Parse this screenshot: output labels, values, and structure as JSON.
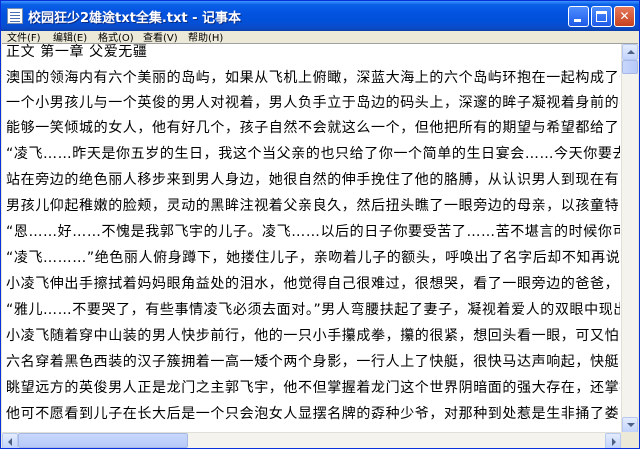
{
  "window": {
    "title": "校园狂少2雄途txt全集.txt - 记事本",
    "minimize_label": "_",
    "maximize_label": "□",
    "close_label": "✕"
  },
  "menu": [
    {
      "label": "文件(F)"
    },
    {
      "label": "编辑(E)"
    },
    {
      "label": "格式(O)"
    },
    {
      "label": "查看(V)"
    },
    {
      "label": "帮助(H)"
    }
  ],
  "content": {
    "lines": [
      "正文 第一章 父爱无疆",
      "澳国的领海内有六个美丽的岛屿，如果从飞机上俯瞰，深蓝大海上的六个岛屿环抱在一起构成了一个很标准",
      "一个小男孩儿与一个英俊的男人对视着，男人负手立于岛边的码头上，深邃的眸子凝视着身前的孩子，目光",
      "能够一笑倾城的女人，他有好几个，孩子自然不会就这么一个，但他把所有的期望与希望都给了身前五岁的",
      "“凌飞……昨天是你五岁的生日，我这个当父亲的也只给了你一个简单的生日宴会……今天你要去哪里",
      "站在旁边的绝色丽人移步来到男人身边，她很自然的伸手挽住了他的胳膊，从认识男人到现在有十多",
      "男孩儿仰起稚嫩的脸颊，灵动的黑眸注视着父亲良久，然后扭头瞧了一眼旁边的母亲，以孩童特有的那种",
      "“恩……好……不愧是我郭飞宇的儿子。凌飞……以后的日子你要受苦了……苦不堪言的时候你可以朝我",
      "“凌飞………”绝色丽人俯身蹲下，她搂住儿子，亲吻着儿子的额头，呼唤出了名字后却不知再说什么",
      "小凌飞伸出手擦拭着妈妈眼角益处的泪水，他觉得自己很难过，很想哭，看了一眼旁边的爸爸，五岁的小凌",
      "“雅儿……不要哭了，有些事情凌飞必须去面对。”男人弯腰扶起了妻子，凝视着爱人的双眼中现出了带有",
      "小凌飞随着穿中山装的男人快步前行，他的一只小手攥成拳，攥的很紧，想回头看一眼，可又怕自己那不争",
      "六名穿着黑色西装的汉子簇拥着一高一矮个两个身影，一行人上了快艇，很快马达声响起，快艇在海面上划",
      "眺望远方的英俊男人正是龙门之主郭飞宇，他不但掌握着龙门这个世界阴暗面的强大存在，还掌握着震撼世",
      "他可不愿看到儿子在长大后是一个只会泡女人显摆名牌的孬种少爷，对那种到处惹是生非捅了娄子等父母擦"
    ]
  }
}
